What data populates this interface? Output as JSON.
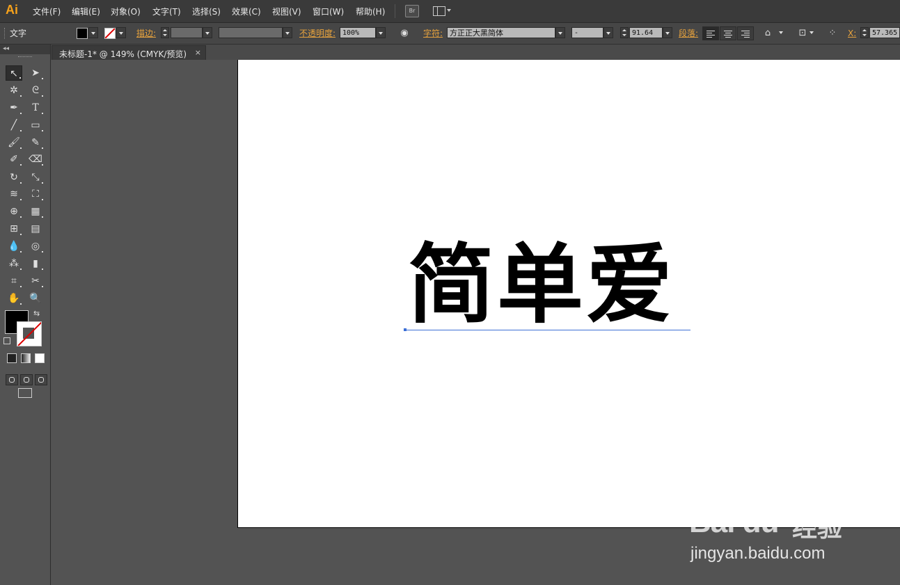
{
  "app": {
    "logo": "Ai"
  },
  "menubar": {
    "items": [
      "文件(F)",
      "编辑(E)",
      "对象(O)",
      "文字(T)",
      "选择(S)",
      "效果(C)",
      "视图(V)",
      "窗口(W)",
      "帮助(H)"
    ],
    "bridge_label": "Br"
  },
  "controlbar": {
    "tool_name": "文字",
    "stroke_label": "描边:",
    "opacity_label": "不透明度:",
    "opacity_value": "100%",
    "character_label": "字符:",
    "font_family": "方正正大黑简体",
    "font_style": "-",
    "font_size": "91.64",
    "paragraph_label": "段落:",
    "x_label": "X:",
    "x_value": "57.365"
  },
  "document": {
    "tab_title": "未标题-1* @ 149% (CMYK/预览)",
    "tab_close": "×",
    "artboard_text": "简单爱"
  },
  "tools": {
    "icons": [
      "selection-tool-icon",
      "direct-selection-tool-icon",
      "magic-wand-tool-icon",
      "lasso-tool-icon",
      "pen-tool-icon",
      "type-tool-icon",
      "line-segment-tool-icon",
      "rectangle-tool-icon",
      "paintbrush-tool-icon",
      "pencil-tool-icon",
      "blob-brush-tool-icon",
      "eraser-tool-icon",
      "rotate-tool-icon",
      "scale-tool-icon",
      "width-tool-icon",
      "free-transform-tool-icon",
      "shape-builder-tool-icon",
      "perspective-grid-tool-icon",
      "mesh-tool-icon",
      "gradient-tool-icon",
      "eyedropper-tool-icon",
      "blend-tool-icon",
      "symbol-sprayer-tool-icon",
      "column-graph-tool-icon",
      "artboard-tool-icon",
      "slice-tool-icon",
      "hand-tool-icon",
      "zoom-tool-icon"
    ]
  },
  "watermark": {
    "logo_text": "Bai  du",
    "cn_text": "经验",
    "url": "jingyan.baidu.com"
  },
  "colors": {
    "accent_orange": "#e8a33d",
    "ui_dark": "#3a3a3a",
    "panel": "#535353",
    "artboard": "#ffffff",
    "selection_blue": "#3c6fd6"
  }
}
